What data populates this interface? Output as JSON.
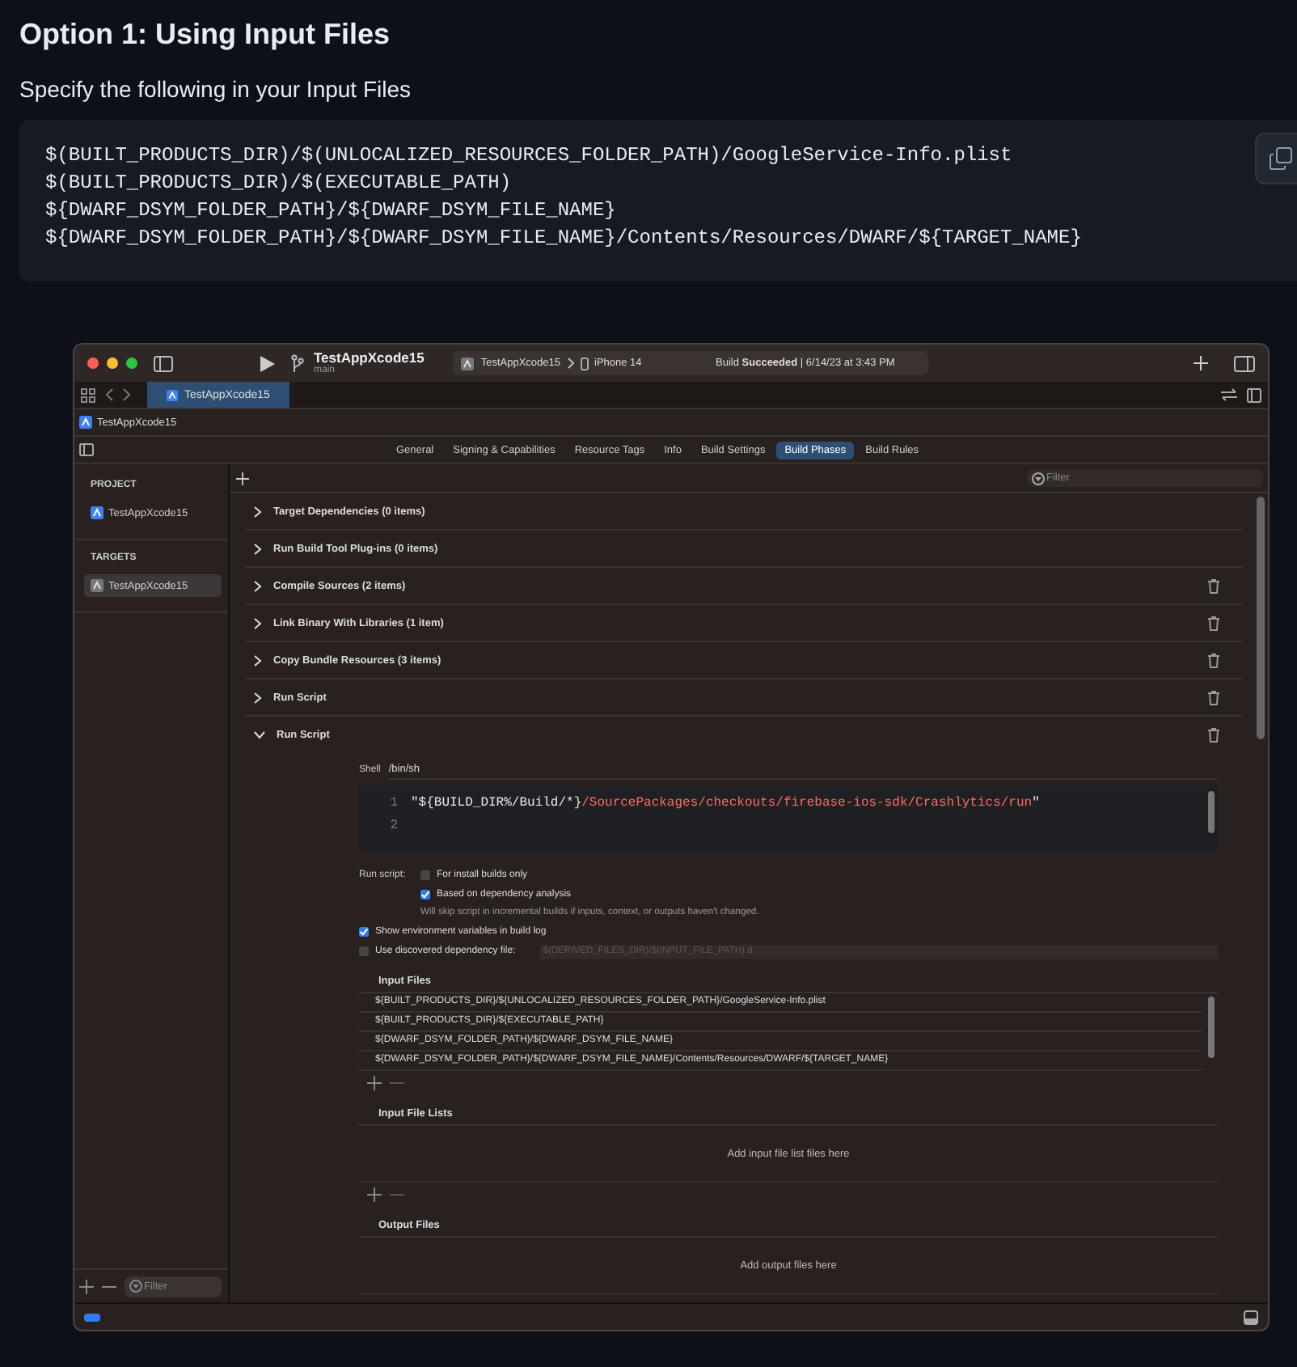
{
  "article": {
    "heading": "Option 1: Using Input Files",
    "intro": "Specify the following in your Input Files",
    "code_lines": [
      "$(BUILT_PRODUCTS_DIR)/$(UNLOCALIZED_RESOURCES_FOLDER_PATH)/GoogleService-Info.plist",
      "$(BUILT_PRODUCTS_DIR)/$(EXECUTABLE_PATH)",
      "${DWARF_DSYM_FOLDER_PATH}/${DWARF_DSYM_FILE_NAME}",
      "${DWARF_DSYM_FOLDER_PATH}/${DWARF_DSYM_FILE_NAME}/Contents/Resources/DWARF/${TARGET_NAME}"
    ]
  },
  "xcode": {
    "toolbar": {
      "project": "TestAppXcode15",
      "branch": "main",
      "scheme": "TestAppXcode15",
      "device": "iPhone 14",
      "status": "Build **Succeeded** | 6/14/23 at 3:43 PM"
    },
    "file_tabs": [
      {
        "label": "TestAppXcode15",
        "selected": true
      }
    ],
    "breadcrumb": "TestAppXcode15",
    "editor_tabs": [
      {
        "label": "General",
        "selected": false
      },
      {
        "label": "Signing & Capabilities",
        "selected": false
      },
      {
        "label": "Resource Tags",
        "selected": false
      },
      {
        "label": "Info",
        "selected": false
      },
      {
        "label": "Build Settings",
        "selected": false
      },
      {
        "label": "Build Phases",
        "selected": true
      },
      {
        "label": "Build Rules",
        "selected": false
      }
    ],
    "sidebar": {
      "sections": [
        {
          "heading": "PROJECT",
          "items": [
            {
              "label": "TestAppXcode15",
              "kind": "project",
              "selected": false
            }
          ]
        },
        {
          "heading": "TARGETS",
          "items": [
            {
              "label": "TestAppXcode15",
              "kind": "target",
              "selected": true
            }
          ]
        }
      ],
      "filter_placeholder": "Filter"
    },
    "filter_placeholder": "Filter",
    "phases": [
      {
        "title": "Target Dependencies (0 items)",
        "expanded": false,
        "deletable": false
      },
      {
        "title": "Run Build Tool Plug-ins (0 items)",
        "expanded": false,
        "deletable": false
      },
      {
        "title": "Compile Sources (2 items)",
        "expanded": false,
        "deletable": true
      },
      {
        "title": "Link Binary With Libraries (1 item)",
        "expanded": false,
        "deletable": true
      },
      {
        "title": "Copy Bundle Resources (3 items)",
        "expanded": false,
        "deletable": true
      },
      {
        "title": "Run Script",
        "expanded": false,
        "deletable": true
      },
      {
        "title": "Run Script",
        "expanded": true,
        "deletable": true
      }
    ],
    "run_script": {
      "shell_label": "Shell",
      "shell": "/bin/sh",
      "code": [
        {
          "number": "1",
          "tokens": [
            {
              "kind": "plain",
              "text": "\"${BUILD_DIR%/Build/*}"
            },
            {
              "kind": "string",
              "text": "/SourcePackages/checkouts/firebase-ios-sdk/Crashlytics/run"
            },
            {
              "kind": "plain",
              "text": "\""
            }
          ]
        },
        {
          "number": "2"
        }
      ],
      "options_label": "Run script:",
      "options": [
        {
          "label": "For install builds only",
          "checked": false,
          "nested": true
        },
        {
          "label": "Based on dependency analysis",
          "checked": true,
          "nested": true,
          "note": "Will skip script in incremental builds if inputs, context, or outputs haven't changed."
        },
        {
          "label": "Show environment variables in build log",
          "checked": true,
          "nested": false
        },
        {
          "label": "Use discovered dependency file:",
          "checked": false,
          "nested": false,
          "field_placeholder": "$(DERIVED_FILES_DIR)/$(INPUT_FILE_PATH).d"
        }
      ],
      "sections": [
        {
          "title": "Input Files",
          "add_remove": true,
          "rows": [
            "${BUILT_PRODUCTS_DIR}/${UNLOCALIZED_RESOURCES_FOLDER_PATH}/GoogleService-Info.plist",
            "${BUILT_PRODUCTS_DIR}/${EXECUTABLE_PATH}",
            "${DWARF_DSYM_FOLDER_PATH}/${DWARF_DSYM_FILE_NAME}",
            "${DWARF_DSYM_FOLDER_PATH}/${DWARF_DSYM_FILE_NAME}/Contents/Resources/DWARF/${TARGET_NAME}"
          ]
        },
        {
          "title": "Input File Lists",
          "add_remove": true,
          "empty_text": "Add input file list files here"
        },
        {
          "title": "Output Files",
          "add_remove": false,
          "empty_text": "Add output files here"
        }
      ]
    }
  }
}
